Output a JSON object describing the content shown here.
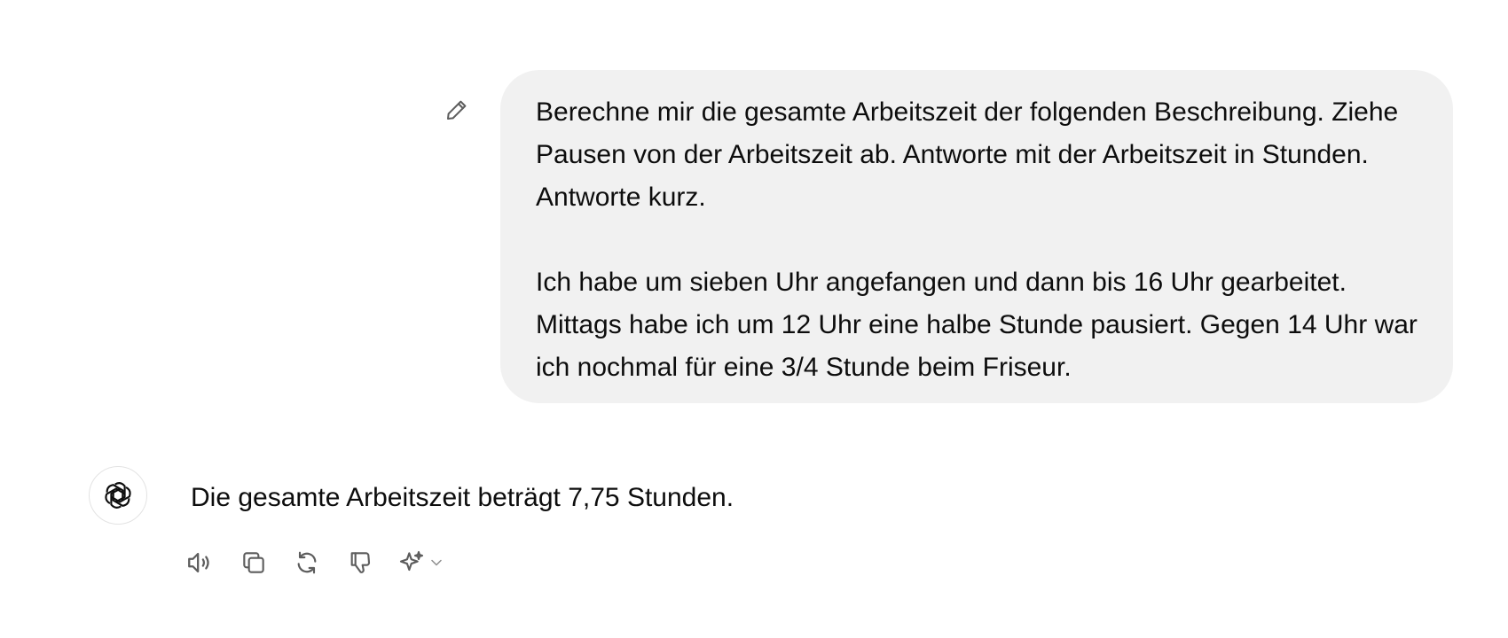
{
  "user_message": {
    "paragraphs": [
      "Berechne mir die gesamte Arbeitszeit der folgenden Beschreibung. Ziehe Pausen von der Arbeitszeit ab. Antworte mit der Arbeitszeit in Stunden. Antworte kurz.",
      "Ich habe um sieben Uhr angefangen und dann bis 16 Uhr gearbeitet. Mittags habe ich um 12 Uhr eine halbe Stunde pausiert. Gegen 14 Uhr war ich nochmal für eine 3/4 Stunde beim Friseur."
    ],
    "edit_icon": "pencil-icon"
  },
  "assistant_message": {
    "avatar_icon": "openai-logo-icon",
    "text": "Die gesamte Arbeitszeit beträgt 7,75 Stunden."
  },
  "actions": [
    {
      "icon": "speaker-icon"
    },
    {
      "icon": "copy-icon"
    },
    {
      "icon": "regenerate-icon"
    },
    {
      "icon": "thumbs-down-icon"
    },
    {
      "icon": "sparkle-icon"
    }
  ],
  "colors": {
    "bubble_bg": "#f1f1f1",
    "text": "#0d0d0d",
    "icon": "#5d5d5d"
  }
}
